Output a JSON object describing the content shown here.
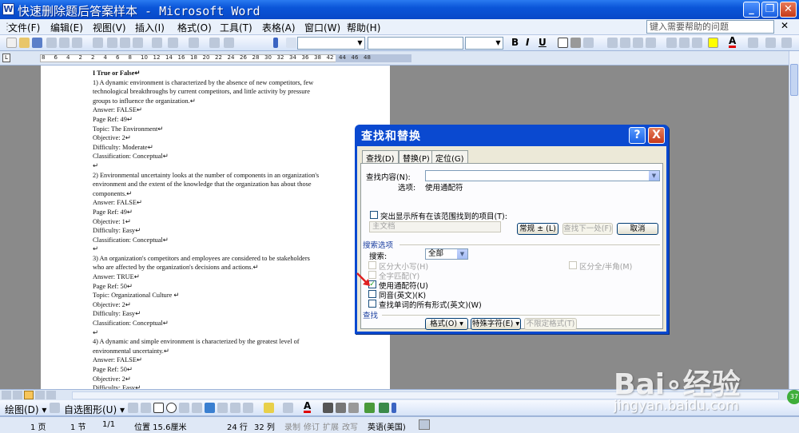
{
  "titlebar": {
    "title": "快速删除题后答案样本 - Microsoft Word",
    "app_icon": "W"
  },
  "menubar": {
    "items": [
      "文件(F)",
      "编辑(E)",
      "视图(V)",
      "插入(I)",
      "格式(O)",
      "工具(T)",
      "表格(A)",
      "窗口(W)",
      "帮助(H)"
    ],
    "help_placeholder": "键入需要帮助的问题"
  },
  "toolbar": {
    "bold": "B",
    "italic": "I",
    "underline": "U",
    "font_color_letter": "A"
  },
  "ruler": {
    "ticks": [
      "8",
      "6",
      "4",
      "2",
      "2",
      "4",
      "6",
      "8",
      "10",
      "12",
      "14",
      "16",
      "18",
      "20",
      "22",
      "24",
      "26",
      "28",
      "30",
      "32",
      "34",
      "36",
      "38",
      "42",
      "44",
      "46",
      "48"
    ]
  },
  "document": {
    "lines": [
      "I  True or False↵",
      "1) A dynamic environment is characterized by the absence of new competitors, few",
      "technological breakthroughs by current competitors, and little activity by pressure",
      "groups to influence the organization.↵",
      "Answer:    FALSE↵",
      "Page Ref: 49↵",
      "Topic:    The Environment↵",
      "Objective:    2↵",
      "Difficulty:    Moderate↵",
      "Classification:    Conceptual↵",
      "↵",
      "2) Environmental uncertainty looks at the number of components in an organization's",
      "environment and the extent of the knowledge that the organization has about those",
      "components.↵",
      "Answer:    FALSE↵",
      "Page Ref: 49↵",
      "Objective:    1↵",
      "Difficulty:    Easy↵",
      "Classification:    Conceptual↵",
      "↵",
      "3) An organization's competitors and employees are considered to be stakeholders",
      "who are affected by the organization's decisions and actions.↵",
      "Answer:    TRUE↵",
      "Page Ref: 50↵",
      "Topic:    Organizational Culture ↵",
      "Objective:    2↵",
      "Difficulty:    Easy↵",
      "Classification:    Conceptual↵",
      "↵",
      "4) A dynamic and simple environment is characterized by the greatest level of",
      "environmental uncertainty.↵",
      "Answer:    FALSE↵",
      "Page Ref: 50↵",
      "Objective:    2↵",
      "Difficulty:    Easy↵"
    ]
  },
  "dialog": {
    "title": "查找和替换",
    "help_btn": "?",
    "close_btn": "X",
    "tabs": [
      "查找(D)",
      "替换(P)",
      "定位(G)"
    ],
    "find_label": "查找内容(N):",
    "options_label": "选项:",
    "options_value": "使用通配符",
    "highlight_label": "突出显示所有在该范围找到的项目(T):",
    "scope_value": "主文档",
    "btn_more": "常规 ± (L)",
    "btn_find_next": "查找下一处(F)",
    "btn_cancel": "取消",
    "search_options_header": "搜索选项",
    "search_label": "搜索:",
    "search_value": "全部",
    "cb_match_case": "区分大小写(H)",
    "cb_whole_word": "全字匹配(Y)",
    "cb_wildcards": "使用通配符(U)",
    "cb_sounds_like": "同音(英文)(K)",
    "cb_all_forms": "查找单词的所有形式(英文)(W)",
    "cb_full_half": "区分全/半角(M)",
    "find_header": "查找",
    "btn_format": "格式(O) ▾",
    "btn_special": "特殊字符(E) ▾",
    "btn_no_format": "不限定格式(T)"
  },
  "drawbar": {
    "draw_label": "绘图(D) ▾",
    "autoshapes_label": "自选图形(U) ▾"
  },
  "statusbar": {
    "page": "1 页",
    "section": "1 节",
    "pages": "1/1",
    "position": "位置 15.6厘米",
    "line": "24 行",
    "column": "32 列",
    "rec": "录制",
    "trk": "修订",
    "ext": "扩展",
    "ovr": "改写",
    "language": "英语(美国)"
  },
  "watermark": {
    "brand": "Bai∘经验",
    "url": "jingyan.baidu.com"
  },
  "badge": {
    "text": "37"
  },
  "colors": {
    "title_blue": "#0a55d8",
    "dialog_blue": "#0a49d0",
    "close_red": "#c53a18",
    "arrow_red": "#e02020",
    "font_red": "#e00000",
    "highlight_yellow": "#ffff00"
  }
}
